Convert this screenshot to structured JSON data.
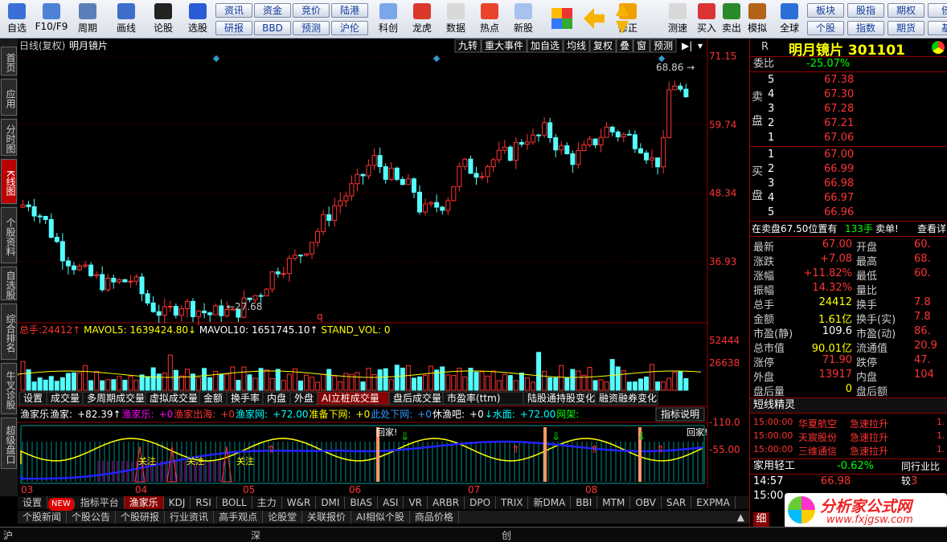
{
  "toolbar": {
    "buttons": [
      "自选",
      "F10/F9",
      "周期",
      "画线",
      "论股",
      "选股",
      "科创",
      "龙虎",
      "数据",
      "热点",
      "新股",
      "修正",
      "测速",
      "买入",
      "卖出",
      "模拟",
      "全球"
    ],
    "row1": [
      "资讯",
      "资金",
      "竞价",
      "陆港"
    ],
    "row2": [
      "研报",
      "BBD",
      "预测",
      "沪伦"
    ],
    "right1": [
      "板块",
      "股指",
      "期权",
      "债"
    ],
    "right2": [
      "个股",
      "指数",
      "期货",
      "基"
    ]
  },
  "side_tabs": [
    "首页",
    "应用",
    "分时图",
    "K线图",
    "个股资料",
    "自选股",
    "综合排名",
    "牛叉诊股",
    "超级盘口"
  ],
  "chart_header": {
    "left": "日线(复权)",
    "name": "明月镜片",
    "buttons": [
      "九转",
      "重大事件",
      "加自选",
      "均线",
      "复权",
      "叠",
      "窗",
      "预测"
    ]
  },
  "price_axis": [
    "71.15",
    "59.74",
    "48.34",
    "36.93"
  ],
  "high_label": "68.86",
  "low_label": "27.68",
  "q_marker": "q",
  "vol_header": {
    "prefix": "总手:",
    "total": "24412↑",
    "ma5_label": "MAVOL5:",
    "ma5": "1639424.80↓",
    "ma10_label": "MAVOL10:",
    "ma10": "1651745.10↑",
    "std_label": "STAND_VOL:",
    "std": "0"
  },
  "vol_axis": [
    "52444",
    "26638"
  ],
  "vol_tabs": [
    "设置",
    "成交量",
    "多周期成交量",
    "虚拟成交量",
    "金额",
    "换手率",
    "内盘",
    "外盘",
    "AI立桩成交量",
    "盘后成交量",
    "市盈率(ttm)",
    "陆股通持股变化",
    "融资融券变化"
  ],
  "ind_header": [
    {
      "t": "渔家乐",
      "c": "#fff"
    },
    {
      "t": "渔家:",
      "c": "#fff"
    },
    {
      "t": "+82.39↑",
      "c": "#fff"
    },
    {
      "t": "渔家乐:",
      "c": "#f0f"
    },
    {
      "t": "+0",
      "c": "#f0f"
    },
    {
      "t": "渔家出海:",
      "c": "#f33"
    },
    {
      "t": "+0",
      "c": "#f33"
    },
    {
      "t": "渔家网:",
      "c": "#0ff"
    },
    {
      "t": "+72.00",
      "c": "#0ff"
    },
    {
      "t": "准备下网:",
      "c": "#ff0"
    },
    {
      "t": "+0",
      "c": "#ff0"
    },
    {
      "t": "此处下网:",
      "c": "#39f"
    },
    {
      "t": "+0",
      "c": "#39f"
    },
    {
      "t": "休渔吧:",
      "c": "#fff"
    },
    {
      "t": "+0",
      "c": "#fff"
    },
    {
      "t": "↓水面:",
      "c": "#0ff"
    },
    {
      "t": "+72.00",
      "c": "#0ff"
    },
    {
      "t": "网架:",
      "c": "#0f0"
    }
  ],
  "ind_button": "指标说明",
  "ind_axis": [
    "110.0",
    "55.00"
  ],
  "ind_labels": {
    "catch": "回家!",
    "catch2": "回家!",
    "lb": "关注"
  },
  "months": [
    "03",
    "04",
    "05",
    "06",
    "07",
    "08"
  ],
  "ind_tabs": [
    "设置",
    "NEW",
    "指标平台",
    "渔家乐",
    "KDJ",
    "RSI",
    "BOLL",
    "主力",
    "W&R",
    "DMI",
    "BIAS",
    "ASI",
    "VR",
    "ARBR",
    "DPO",
    "TRIX",
    "新DMA",
    "BBI",
    "MTM",
    "OBV",
    "SAR",
    "EXPMA"
  ],
  "bottom_tabs": [
    "个股新闻",
    "个股公告",
    "个股研报",
    "行业资讯",
    "高手观点",
    "论股堂",
    "关联报价",
    "AI相似个股",
    "商品价格"
  ],
  "status_items": [
    "沪",
    "深",
    "创"
  ],
  "panel": {
    "r": "R",
    "title": "明月镜片 301101",
    "weibi_label": "委比",
    "weibi": "-25.07%",
    "sell_label": "卖盘",
    "buy_label": "买盘",
    "asks": [
      [
        "5",
        "67.38"
      ],
      [
        "4",
        "67.30"
      ],
      [
        "3",
        "67.28"
      ],
      [
        "2",
        "67.21"
      ],
      [
        "1",
        "67.06"
      ]
    ],
    "bids": [
      [
        "1",
        "67.00"
      ],
      [
        "2",
        "66.99"
      ],
      [
        "3",
        "66.98"
      ],
      [
        "4",
        "66.97"
      ],
      [
        "5",
        "66.96"
      ]
    ],
    "notice": "在卖盘67.50位置有",
    "notice_vol": "133手",
    "notice_tag": "卖单!",
    "notice_link": "查看详",
    "quotes": [
      [
        "最新",
        "67.00",
        "red",
        "开盘",
        "60."
      ],
      [
        "涨跌",
        "+7.08",
        "red",
        "最高",
        "68."
      ],
      [
        "涨幅",
        "+11.82%",
        "red",
        "最低",
        "60."
      ],
      [
        "振幅",
        "14.32%",
        "red",
        "量比",
        ""
      ],
      [
        "总手",
        "24412",
        "yel",
        "换手",
        "7.8"
      ],
      [
        "金额",
        "1.61亿",
        "yel",
        "换手(实)",
        "7.8"
      ],
      [
        "市盈(静)",
        "109.6",
        "wht",
        "市盈(动)",
        "86."
      ],
      [
        "总市值",
        "90.01亿",
        "yel",
        "流通值",
        "20.9"
      ],
      [
        "涨停",
        "71.90",
        "red",
        "跌停",
        "47."
      ],
      [
        "外盘",
        "13917",
        "red",
        "内盘",
        "104"
      ],
      [
        "盘后量",
        "0",
        "yel",
        "盘后额",
        ""
      ]
    ],
    "section": "短线精灵",
    "sprite": [
      [
        "15:00:00",
        "华夏航空",
        "急速拉升",
        "1."
      ],
      [
        "15:00:00",
        "天宸股份",
        "急速拉升",
        "1."
      ],
      [
        "15:00:00",
        "三维通信",
        "急速拉升",
        "1."
      ]
    ],
    "industry": "家用轻工",
    "industry_pct": "-0.62%",
    "industry_cmp": "同行业比较",
    "trade_time": "14:57",
    "trade_price": "66.98",
    "trade_vol": "3",
    "trade_time2": "15:00",
    "tick_tab": "细"
  },
  "watermark": {
    "cn": "分析家公式网",
    "url": "www.fxjgsw.com"
  },
  "chart_data": {
    "type": "candlestick",
    "title": "明月镜片",
    "y_axis": [
      71.15,
      59.74,
      48.34,
      36.93
    ],
    "high": 68.86,
    "low": 27.68
  }
}
